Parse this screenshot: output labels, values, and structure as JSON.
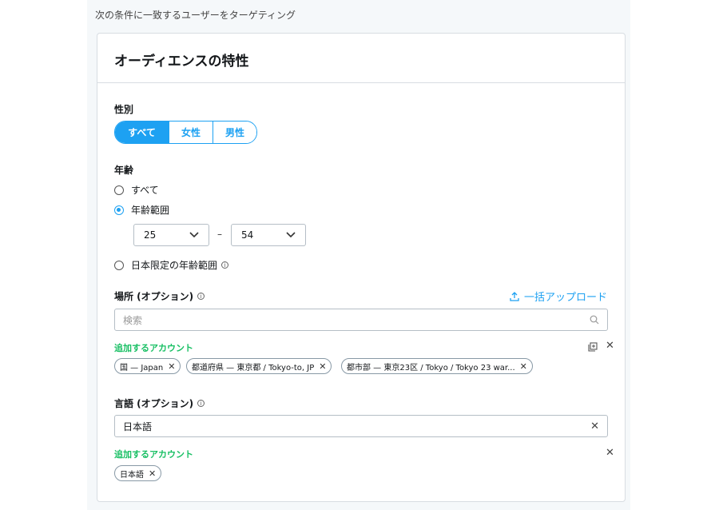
{
  "header_hint": "次の条件に一致するユーザーをターゲティング",
  "card": {
    "title": "オーディエンスの特性"
  },
  "gender": {
    "label": "性別",
    "options": [
      "すべて",
      "女性",
      "男性"
    ],
    "selected": "すべて"
  },
  "age": {
    "label": "年齢",
    "options": [
      "すべて",
      "年齢範囲",
      "日本限定の年齢範囲"
    ],
    "selected": "年齢範囲",
    "min": "25",
    "max": "54",
    "dash": "–"
  },
  "location": {
    "label": "場所 (オプション)",
    "upload_label": "一括アップロード",
    "search_placeholder": "検索",
    "added_label": "追加するアカウント",
    "tags": [
      "国 — Japan",
      "都道府県 — 東京都 / Tokyo-to, JP",
      "都市部 — 東京23区 / Tokyo / Tokyo 23 war..."
    ]
  },
  "language": {
    "label": "言語 (オプション)",
    "input_value": "日本語",
    "added_label": "追加するアカウント",
    "tags": [
      "日本語"
    ]
  },
  "colors": {
    "accent": "#1da1f2",
    "green": "#17bf63"
  }
}
